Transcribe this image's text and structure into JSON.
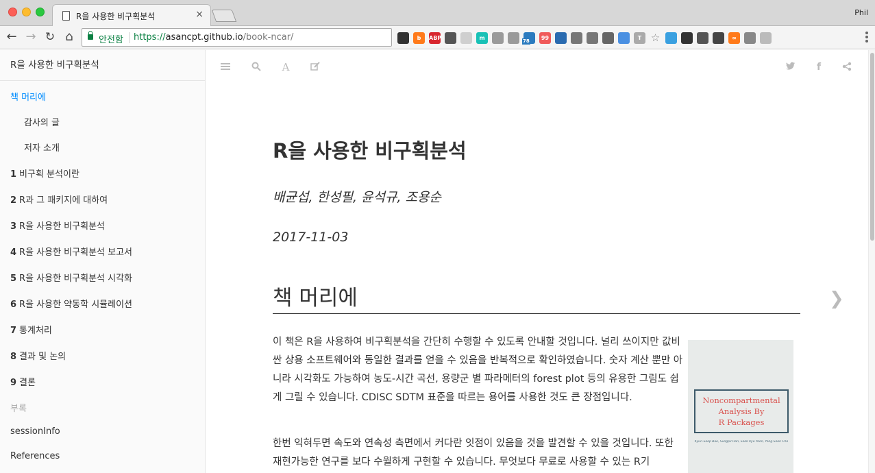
{
  "browser": {
    "tab_title": "R을 사용한 비구획분석",
    "tab_close": "×",
    "profile_name": "Phil",
    "secure_label": "안전함",
    "url_protocol": "https://",
    "url_host": "asancpt.github.io",
    "url_path": "/book-ncar/",
    "extension_badge": "78",
    "extensions": [
      {
        "name": "grid-extension-icon",
        "label": "",
        "color": "#333333"
      },
      {
        "name": "bolt-extension-icon",
        "label": "b",
        "color": "#ff7a1a"
      },
      {
        "name": "adblock-extension-icon",
        "label": "ABP",
        "color": "#d8262e"
      },
      {
        "name": "incognito-extension-icon",
        "label": "",
        "color": "#555555"
      },
      {
        "name": "image-extension-icon",
        "label": "",
        "color": "#cfcfcf"
      },
      {
        "name": "m-extension-icon",
        "label": "m",
        "color": "#19c1b6"
      },
      {
        "name": "drive-extension-icon",
        "label": "",
        "color": "#9a9a9a"
      },
      {
        "name": "dropbox-extension-icon",
        "label": "",
        "color": "#9a9a9a"
      },
      {
        "name": "cloud-badge-extension-icon",
        "label": "",
        "color": "#2b7bbf"
      },
      {
        "name": "quote-extension-icon",
        "label": "99",
        "color": "#f05a5a"
      },
      {
        "name": "notebook-extension-icon",
        "label": "",
        "color": "#2a6bb0"
      },
      {
        "name": "octocat-extension-icon",
        "label": "",
        "color": "#777777"
      },
      {
        "name": "cast-extension-icon",
        "label": "",
        "color": "#777777"
      },
      {
        "name": "bridge-extension-icon",
        "label": "",
        "color": "#666666"
      },
      {
        "name": "diamond-extension-icon",
        "label": "",
        "color": "#4a90e2"
      },
      {
        "name": "t-extension-icon",
        "label": "T",
        "color": "#aaaaaa"
      },
      {
        "name": "star-icon",
        "label": "☆",
        "color": "#888888"
      },
      {
        "name": "cloud-extension-icon",
        "label": "",
        "color": "#3aa0e0"
      },
      {
        "name": "color-wheel-extension-icon",
        "label": "",
        "color": "#333333"
      },
      {
        "name": "bulb-extension-icon",
        "label": "",
        "color": "#555555"
      },
      {
        "name": "crop-add-extension-icon",
        "label": "",
        "color": "#444444"
      },
      {
        "name": "infinity-extension-icon",
        "label": "∞",
        "color": "#ff7a1a"
      },
      {
        "name": "square-extension-icon",
        "label": "",
        "color": "#888888"
      },
      {
        "name": "gray-extension-icon",
        "label": "",
        "color": "#bbbbbb"
      }
    ]
  },
  "sidebar": {
    "title": "R을 사용한 비구획분석",
    "items": [
      {
        "num": "",
        "label": "책 머리에",
        "level": "top",
        "state": "active"
      },
      {
        "num": "",
        "label": "감사의 글",
        "level": "sub",
        "state": "normal"
      },
      {
        "num": "",
        "label": "저자 소개",
        "level": "sub",
        "state": "normal"
      },
      {
        "num": "1",
        "label": "비구획 분석이란",
        "level": "top",
        "state": "normal"
      },
      {
        "num": "2",
        "label": "R과 그 패키지에 대하여",
        "level": "top",
        "state": "normal"
      },
      {
        "num": "3",
        "label": "R을 사용한 비구획분석",
        "level": "top",
        "state": "normal"
      },
      {
        "num": "4",
        "label": "R을 사용한 비구획분석 보고서",
        "level": "top",
        "state": "normal"
      },
      {
        "num": "5",
        "label": "R을 사용한 비구획분석 시각화",
        "level": "top",
        "state": "normal"
      },
      {
        "num": "6",
        "label": "R을 사용한 약동학 시뮬레이션",
        "level": "top",
        "state": "normal"
      },
      {
        "num": "7",
        "label": "통계처리",
        "level": "top",
        "state": "normal"
      },
      {
        "num": "8",
        "label": "결과 및 논의",
        "level": "top",
        "state": "normal"
      },
      {
        "num": "9",
        "label": "결론",
        "level": "top",
        "state": "normal"
      },
      {
        "num": "",
        "label": "부록",
        "level": "top",
        "state": "muted"
      },
      {
        "num": "",
        "label": "sessionInfo",
        "level": "top",
        "state": "normal"
      },
      {
        "num": "",
        "label": "References",
        "level": "top",
        "state": "normal"
      }
    ]
  },
  "book": {
    "title": "R을 사용한 비구획분석",
    "authors": "배균섭, 한성필, 윤석규, 조용순",
    "date": "2017-11-03",
    "section_heading": "책 머리에",
    "paragraph_1": "이 책은 R을 사용하여 비구획분석을 간단히 수행할 수 있도록 안내할 것입니다. 널리 쓰이지만 값비싼 상용 소프트웨어와 동일한 결과를 얻을 수 있음을 반복적으로 확인하였습니다. 숫자 계산 뿐만 아니라 시각화도 가능하여 농도-시간 곡선, 용량군 별 파라메터의 forest plot 등의 유용한 그림도 쉽게 그릴 수 있습니다. CDISC SDTM 표준을 따르는 용어를 사용한 것도 큰 장점입니다.",
    "paragraph_2": "한번 익혀두면 속도와 연속성 측면에서 커다란 잇점이 있음을 것을 발견할 수 있을 것입니다. 또한 재현가능한 연구를 보다 수월하게 구현할 수 있습니다. 무엇보다 무료로 사용할 수 있는 R기",
    "cover_title_line1": "Noncompartmental",
    "cover_title_line2": "Analysis By",
    "cover_title_line3": "R Packages",
    "cover_authors": "Kyun-Seop Bae, Sungpil Han, Seok Kyu Yoon, Yong-Soon Cho"
  }
}
